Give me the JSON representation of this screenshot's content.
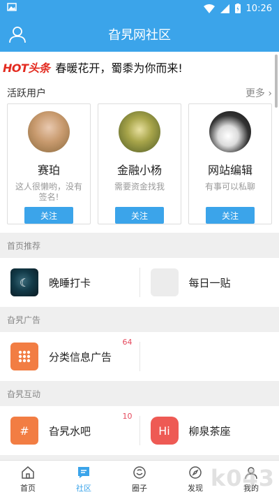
{
  "status": {
    "time": "10:26"
  },
  "header": {
    "title": "旮旯网社区"
  },
  "headline": {
    "badge": "HOT头条",
    "text": "春暖花开，蜀黍为你而来!"
  },
  "active_users": {
    "title": "活跃用户",
    "more": "更多",
    "users": [
      {
        "name": "赛珀",
        "desc": "这人很懒哟，没有签名!",
        "follow": "关注"
      },
      {
        "name": "金融小杨",
        "desc": "需要资金找我",
        "follow": "关注"
      },
      {
        "name": "网站编辑",
        "desc": "有事可以私聊",
        "follow": "关注"
      }
    ]
  },
  "groups": [
    {
      "title": "首页推荐",
      "items": [
        {
          "label": "晚睡打卡",
          "badge": ""
        },
        {
          "label": "每日一贴",
          "badge": ""
        }
      ]
    },
    {
      "title": "旮旯广告",
      "items": [
        {
          "label": "分类信息广告",
          "badge": "64"
        }
      ]
    },
    {
      "title": "旮旯互动",
      "items": [
        {
          "label": "旮旯水吧",
          "badge": "10"
        },
        {
          "label": "柳泉茶座",
          "badge": ""
        }
      ]
    }
  ],
  "tabs": [
    {
      "label": "首页",
      "icon": "home-icon"
    },
    {
      "label": "社区",
      "icon": "community-icon"
    },
    {
      "label": "圈子",
      "icon": "circle-icon"
    },
    {
      "label": "发现",
      "icon": "discover-icon"
    },
    {
      "label": "我的",
      "icon": "profile-icon"
    }
  ],
  "colors": {
    "primary": "#3ba4ea",
    "hot": "#e32a1f",
    "badge": "#e5485c",
    "orange": "#f27d43",
    "red": "#ee5a54"
  },
  "watermark": "k043"
}
